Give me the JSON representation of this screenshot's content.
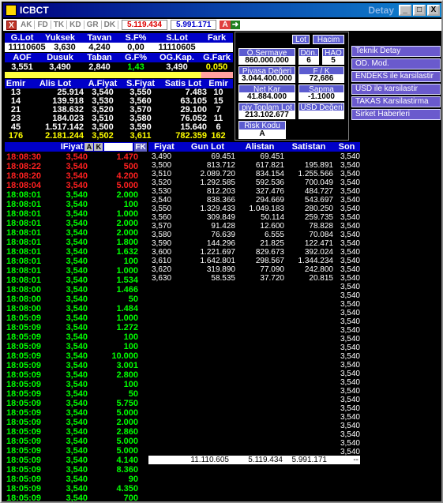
{
  "window": {
    "title": "ICBCT",
    "subtitle": "Detay",
    "min": "_",
    "max": "□",
    "close": "X"
  },
  "toolbar": {
    "close": "X",
    "items": [
      "AK",
      "FD",
      "TK",
      "KD",
      "GR",
      "DK"
    ],
    "val1": "5.119.434",
    "val2": "5.991.171",
    "a_btn": "A"
  },
  "summary": {
    "headers": [
      "G.Lot",
      "Yuksek",
      "Tavan",
      "S.F%",
      "S.Lot",
      "Fark"
    ],
    "values": [
      "11110605",
      "3,630",
      "4,240",
      "0,00",
      "11110605",
      ""
    ],
    "headers2": [
      "AOF",
      "Dusuk",
      "Taban",
      "G.F%",
      "OG.Kap.",
      "G.Fark"
    ],
    "values2": [
      "3,551",
      "3,490",
      "2,840",
      "1,43",
      "3,490",
      "0,050"
    ]
  },
  "panel": {
    "lot": "Lot",
    "hacim": "Hacim",
    "o_sermaye": "Ö.Sermaye",
    "o_sermaye_val": "860.000.000",
    "don": "Dön.",
    "don_val": "6",
    "hao": "HAO",
    "hao_val": "5",
    "piyasa": "Piyasa Değeri",
    "piyasa_val": "3.044.400.000",
    "fk": "F / K",
    "fk_val": "72,686",
    "net_kar": "Net Kar",
    "net_kar_val": "41.884.000",
    "sapma": "Sapma",
    "sapma_val": "-1.1000",
    "piy_toplam": "piy.Toplam Lot",
    "piy_toplam_val": "213.102.677",
    "usd": "USD Değeri",
    "risk": "Risk Kodu",
    "risk_val": "A"
  },
  "side_buttons": [
    "Teknik Detay",
    "OD. Mod.",
    "ENDEKS ile karsilastir",
    "USD ile karsilastir",
    "TAKAS Karsilastirma",
    "Sirket Haberleri"
  ],
  "book": {
    "headers": [
      "Emir",
      "Alis Lot",
      "A.Fiyat",
      "S.Fiyat",
      "Satis Lot",
      "Emir"
    ],
    "rows": [
      [
        "13",
        "25.914",
        "3,540",
        "3,550",
        "7.483",
        "10"
      ],
      [
        "14",
        "139.918",
        "3,530",
        "3,560",
        "63.105",
        "15"
      ],
      [
        "21",
        "138.632",
        "3,520",
        "3,570",
        "29.100",
        "7"
      ],
      [
        "23",
        "184.023",
        "3,510",
        "3,580",
        "76.052",
        "11"
      ],
      [
        "45",
        "1.517.142",
        "3,500",
        "3,590",
        "15.640",
        "6"
      ],
      [
        "176",
        "2.181.244",
        "3,502",
        "3,611",
        "782.359",
        "162"
      ]
    ]
  },
  "trades": {
    "header_fiyat": "IFiyat",
    "header_a": "A",
    "header_k": "K",
    "header_fk": "FK",
    "rows": [
      [
        "18:08:30",
        "3,540",
        "1.470",
        "r"
      ],
      [
        "18:08:22",
        "3,540",
        "500",
        "r"
      ],
      [
        "18:08:20",
        "3,540",
        "4.200",
        "r"
      ],
      [
        "18:08:04",
        "3,540",
        "5.000",
        "r"
      ],
      [
        "18:08:01",
        "3,540",
        "2.000",
        "g"
      ],
      [
        "18:08:01",
        "3,540",
        "100",
        "g"
      ],
      [
        "18:08:01",
        "3,540",
        "1.000",
        "g"
      ],
      [
        "18:08:01",
        "3,540",
        "2.000",
        "g"
      ],
      [
        "18:08:01",
        "3,540",
        "2.000",
        "g"
      ],
      [
        "18:08:01",
        "3,540",
        "1.800",
        "g"
      ],
      [
        "18:08:01",
        "3,540",
        "1.632",
        "g"
      ],
      [
        "18:08:01",
        "3,540",
        "100",
        "g"
      ],
      [
        "18:08:01",
        "3,540",
        "1.000",
        "g"
      ],
      [
        "18:08:01",
        "3,540",
        "1.534",
        "g"
      ],
      [
        "18:08:00",
        "3,540",
        "1.466",
        "g"
      ],
      [
        "18:08:00",
        "3,540",
        "50",
        "g"
      ],
      [
        "18:08:00",
        "3,540",
        "1.484",
        "g"
      ],
      [
        "18:05:09",
        "3,540",
        "1.000",
        "g"
      ],
      [
        "18:05:09",
        "3,540",
        "1.272",
        "g"
      ],
      [
        "18:05:09",
        "3,540",
        "100",
        "g"
      ],
      [
        "18:05:09",
        "3,540",
        "100",
        "g"
      ],
      [
        "18:05:09",
        "3,540",
        "10.000",
        "g"
      ],
      [
        "18:05:09",
        "3,540",
        "3.001",
        "g"
      ],
      [
        "18:05:09",
        "3,540",
        "2.800",
        "g"
      ],
      [
        "18:05:09",
        "3,540",
        "100",
        "g"
      ],
      [
        "18:05:09",
        "3,540",
        "50",
        "g"
      ],
      [
        "18:05:09",
        "3,540",
        "5.750",
        "g"
      ],
      [
        "18:05:09",
        "3,540",
        "5.000",
        "g"
      ],
      [
        "18:05:09",
        "3,540",
        "2.000",
        "g"
      ],
      [
        "18:05:09",
        "3,540",
        "2.860",
        "g"
      ],
      [
        "18:05:09",
        "3,540",
        "5.000",
        "g"
      ],
      [
        "18:05:09",
        "3,540",
        "5.000",
        "g"
      ],
      [
        "18:05:09",
        "3,540",
        "4.140",
        "g"
      ],
      [
        "18:05:09",
        "3,540",
        "8.360",
        "g"
      ],
      [
        "18:05:09",
        "3,540",
        "90",
        "g"
      ],
      [
        "18:05:09",
        "3,540",
        "4.350",
        "g"
      ],
      [
        "18:05:09",
        "3,540",
        "700",
        "g"
      ]
    ]
  },
  "depth": {
    "headers": [
      "Fiyat",
      "Gun Lot",
      "Alistan",
      "Satistan",
      "Son"
    ],
    "rows": [
      [
        "3,490",
        "69.451",
        "69.451",
        "",
        "3,540"
      ],
      [
        "3,500",
        "813.712",
        "617.821",
        "195.891",
        "3,540"
      ],
      [
        "3,510",
        "2.089.720",
        "834.154",
        "1.255.566",
        "3,540"
      ],
      [
        "3,520",
        "1.292.585",
        "592.536",
        "700.049",
        "3,540"
      ],
      [
        "3,530",
        "812.203",
        "327.476",
        "484.727",
        "3,540"
      ],
      [
        "3,540",
        "838.366",
        "294.669",
        "543.697",
        "3,540"
      ],
      [
        "3,550",
        "1.329.433",
        "1.049.183",
        "280.250",
        "3,540"
      ],
      [
        "3,560",
        "309.849",
        "50.114",
        "259.735",
        "3,540"
      ],
      [
        "3,570",
        "91.428",
        "12.600",
        "78.828",
        "3,540"
      ],
      [
        "3,580",
        "76.639",
        "6.555",
        "70.084",
        "3,540"
      ],
      [
        "3,590",
        "144.296",
        "21.825",
        "122.471",
        "3,540"
      ],
      [
        "3,600",
        "1.221.697",
        "829.673",
        "392.024",
        "3,540"
      ],
      [
        "3,610",
        "1.642.801",
        "298.567",
        "1.344.234",
        "3,540"
      ],
      [
        "3,620",
        "319.890",
        "77.090",
        "242.800",
        "3,540"
      ],
      [
        "3,630",
        "58.535",
        "37.720",
        "20.815",
        "3,540"
      ]
    ],
    "son_values": [
      "3,540",
      "3,540",
      "3,540",
      "3,540",
      "3,540",
      "3,540",
      "3,540",
      "3,540",
      "3,540",
      "3,540",
      "3,540",
      "3,540",
      "3,540",
      "3,540",
      "3,540",
      "3,540",
      "3,540",
      "3,540",
      "3,540",
      "3,540",
      "3,540"
    ],
    "footer": [
      "11.110.605",
      "5.119.434",
      "5.991.171",
      "--"
    ]
  }
}
